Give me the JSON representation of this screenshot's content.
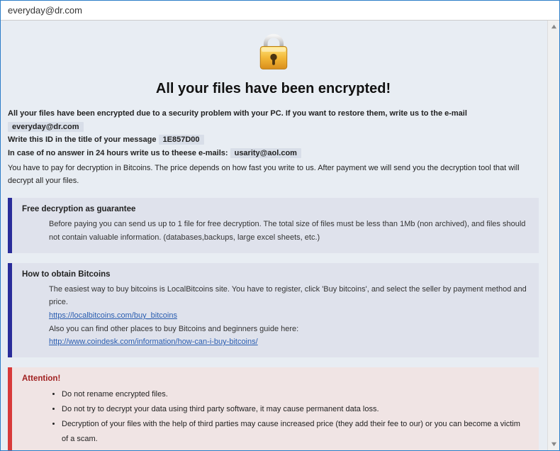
{
  "window": {
    "title": "everyday@dr.com"
  },
  "lock": {
    "name": "lock-icon"
  },
  "heading": "All your files have been encrypted!",
  "intro": {
    "line1a": "All your files have been encrypted due to a security problem with your PC. If you want to restore them, write us to the e-mail ",
    "email1": "everyday@dr.com",
    "line2a": "Write this ID in the title of your message ",
    "id": "1E857D00",
    "line3a": "In case of no answer in 24 hours write us to theese e-mails: ",
    "email2": "usarity@aol.com",
    "note": "You have to pay for decryption in Bitcoins. The price depends on how fast you write to us. After payment we will send you the decryption tool that will decrypt all your files."
  },
  "panels": {
    "free": {
      "title": "Free decryption as guarantee",
      "body": "Before paying you can send us up to 1 file for free decryption. The total size of files must be less than 1Mb (non archived), and files should not contain valuable information. (databases,backups, large excel sheets, etc.)"
    },
    "obtain": {
      "title": "How to obtain Bitcoins",
      "body1": "The easiest way to buy bitcoins is LocalBitcoins site. You have to register, click 'Buy bitcoins', and select the seller by payment method and price.",
      "link1": "https://localbitcoins.com/buy_bitcoins",
      "body2": "Also you can find other places to buy Bitcoins and beginners guide here:",
      "link2": "http://www.coindesk.com/information/how-can-i-buy-bitcoins/"
    },
    "attention": {
      "title": "Attention!",
      "items": [
        "Do not rename encrypted files.",
        "Do not try to decrypt your data using third party software, it may cause permanent data loss.",
        "Decryption of your files with the help of third parties may cause increased price (they add their fee to our) or you can become a victim of a scam."
      ]
    }
  }
}
